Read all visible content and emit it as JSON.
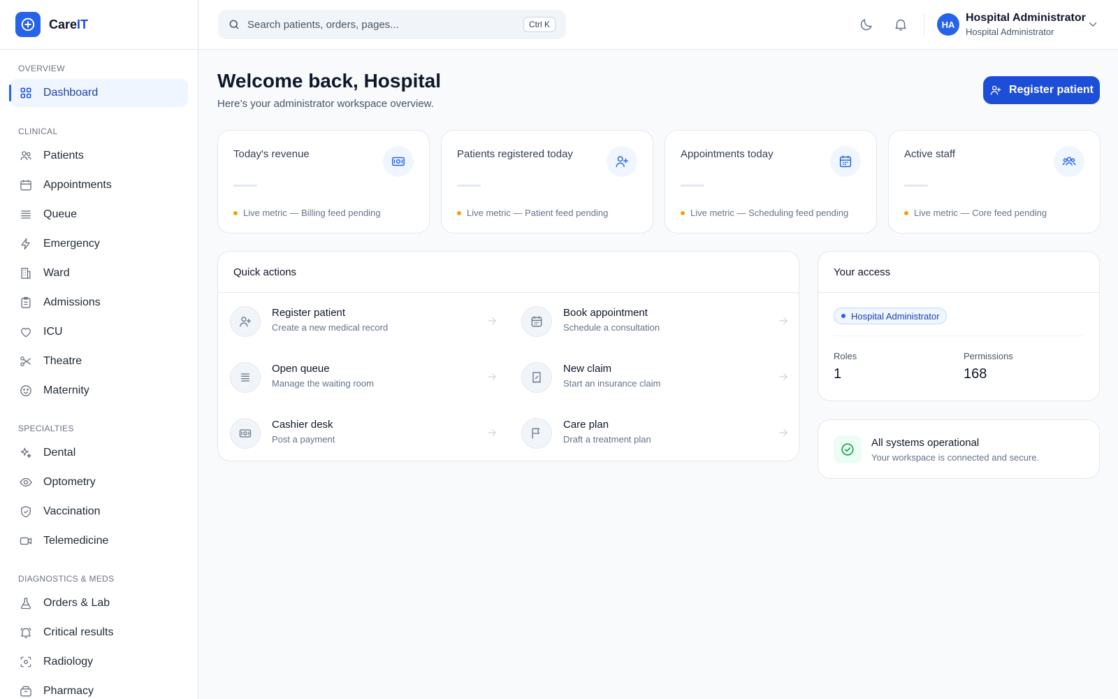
{
  "brand": {
    "name_a": "Care",
    "name_b": "IT"
  },
  "sidebar": {
    "sections": [
      {
        "label": "OVERVIEW",
        "items": [
          {
            "label": "Dashboard",
            "icon": "grid-icon",
            "active": true
          }
        ]
      },
      {
        "label": "CLINICAL",
        "items": [
          {
            "label": "Patients",
            "icon": "users-icon"
          },
          {
            "label": "Appointments",
            "icon": "calendar-icon"
          },
          {
            "label": "Queue",
            "icon": "list-icon"
          },
          {
            "label": "Emergency",
            "icon": "bolt-icon"
          },
          {
            "label": "Ward",
            "icon": "building-icon"
          },
          {
            "label": "Admissions",
            "icon": "clipboard-icon"
          },
          {
            "label": "ICU",
            "icon": "heart-icon"
          },
          {
            "label": "Theatre",
            "icon": "scissors-icon"
          },
          {
            "label": "Maternity",
            "icon": "smile-icon"
          }
        ]
      },
      {
        "label": "SPECIALTIES",
        "items": [
          {
            "label": "Dental",
            "icon": "sparkle-icon"
          },
          {
            "label": "Optometry",
            "icon": "eye-icon"
          },
          {
            "label": "Vaccination",
            "icon": "shield-check-icon"
          },
          {
            "label": "Telemedicine",
            "icon": "video-icon"
          }
        ]
      },
      {
        "label": "DIAGNOSTICS & MEDS",
        "items": [
          {
            "label": "Orders & Lab",
            "icon": "flask-icon"
          },
          {
            "label": "Critical results",
            "icon": "bell-alert-icon"
          },
          {
            "label": "Radiology",
            "icon": "scan-icon"
          },
          {
            "label": "Pharmacy",
            "icon": "box-icon"
          }
        ]
      }
    ]
  },
  "topbar": {
    "search_placeholder": "Search patients, orders, pages...",
    "shortcut": "Ctrl K",
    "user_initials": "HA",
    "user_name": "Hospital Administrator",
    "user_role": "Hospital Administrator"
  },
  "main": {
    "title": "Welcome back, Hospital",
    "subtitle": "Here’s your administrator workspace overview.",
    "primary_button": "Register patient"
  },
  "stats": [
    {
      "label": "Today's revenue",
      "note": "Live metric — Billing feed pending",
      "icon": "banknote-icon"
    },
    {
      "label": "Patients registered today",
      "note": "Live metric — Patient feed pending",
      "icon": "user-plus-icon"
    },
    {
      "label": "Appointments today",
      "note": "Live metric — Scheduling feed pending",
      "icon": "calendar-icon"
    },
    {
      "label": "Active staff",
      "note": "Live metric — Core feed pending",
      "icon": "team-icon"
    }
  ],
  "quick_actions": {
    "title": "Quick actions",
    "items": [
      {
        "title": "Register patient",
        "desc": "Create a new medical record",
        "icon": "user-plus-icon"
      },
      {
        "title": "Book appointment",
        "desc": "Schedule a consultation",
        "icon": "calendar-icon"
      },
      {
        "title": "Open queue",
        "desc": "Manage the waiting room",
        "icon": "list-icon"
      },
      {
        "title": "New claim",
        "desc": "Start an insurance claim",
        "icon": "receipt-icon"
      },
      {
        "title": "Cashier desk",
        "desc": "Post a payment",
        "icon": "banknote-icon"
      },
      {
        "title": "Care plan",
        "desc": "Draft a treatment plan",
        "icon": "flag-icon"
      }
    ]
  },
  "access": {
    "title": "Your access",
    "role": "Hospital Administrator",
    "roles_label": "Roles",
    "roles_value": "1",
    "permissions_label": "Permissions",
    "permissions_value": "168"
  },
  "status": {
    "title": "All systems operational",
    "desc": "Your workspace is connected and secure."
  },
  "colors": {
    "accent": "#1d4ed8",
    "status_ok": "#16a34a",
    "pending": "#f59e0b"
  }
}
